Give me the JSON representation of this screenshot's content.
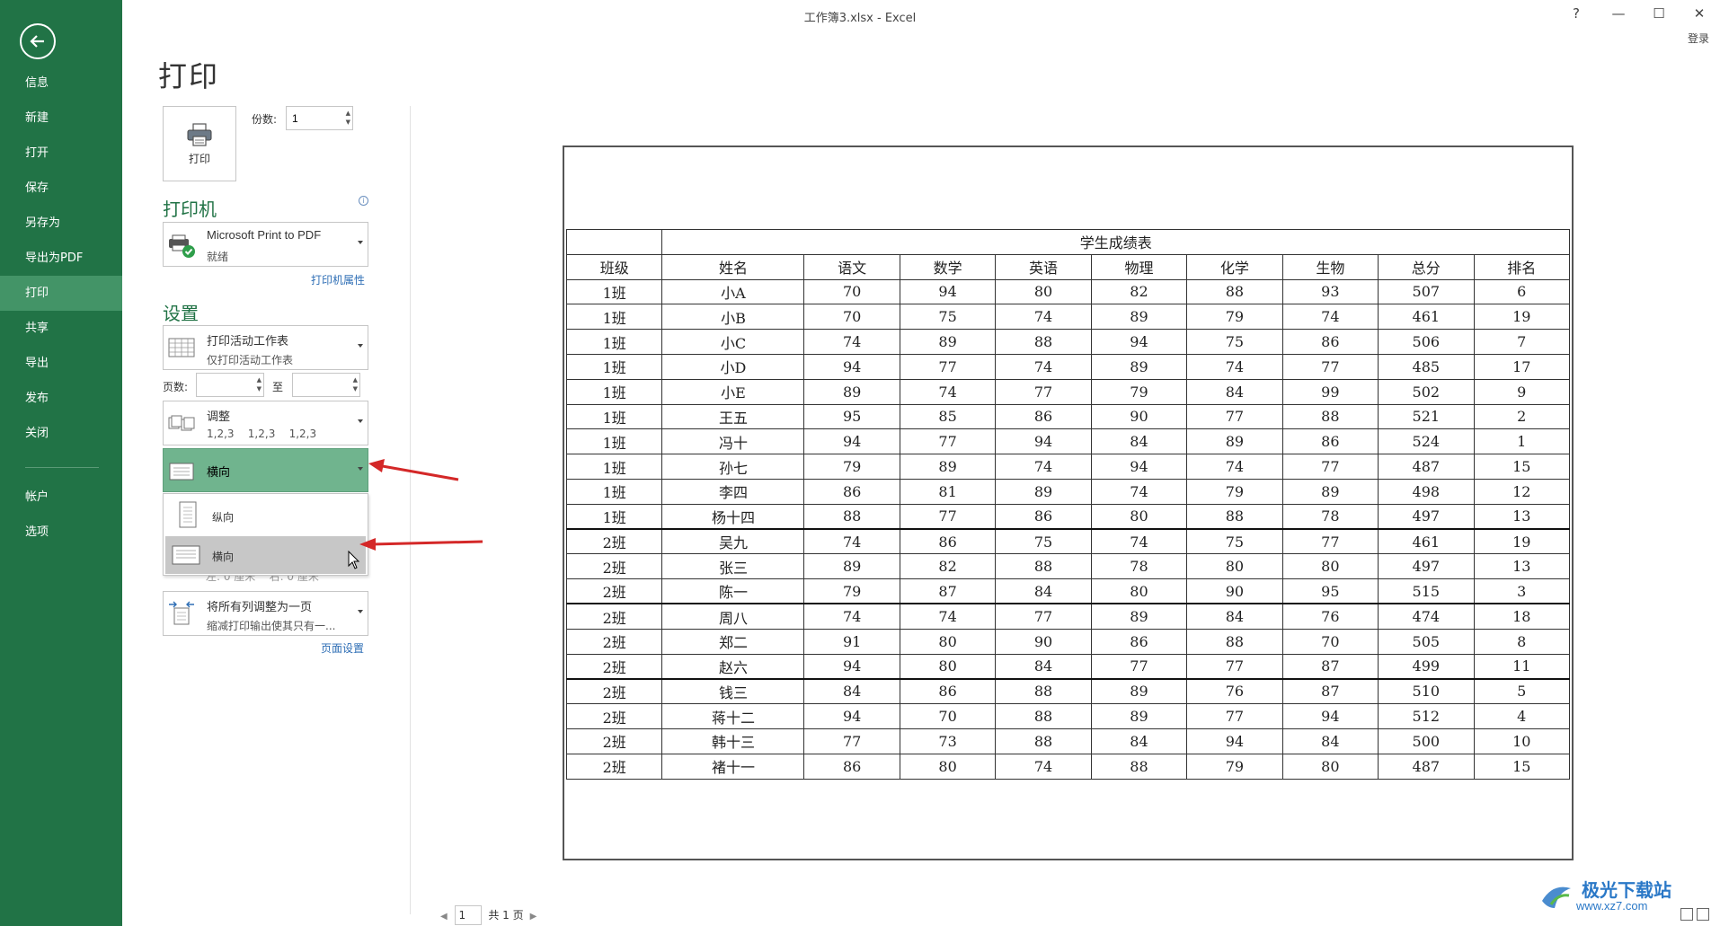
{
  "window": {
    "title": "工作簿3.xlsx - Excel",
    "help": "?",
    "minimize": "—",
    "maximize": "☐",
    "close": "✕",
    "login": "登录"
  },
  "sidebar": {
    "items": [
      {
        "label": "信息"
      },
      {
        "label": "新建"
      },
      {
        "label": "打开"
      },
      {
        "label": "保存"
      },
      {
        "label": "另存为"
      },
      {
        "label": "导出为PDF"
      },
      {
        "label": "打印"
      },
      {
        "label": "共享"
      },
      {
        "label": "导出"
      },
      {
        "label": "发布"
      },
      {
        "label": "关闭"
      }
    ],
    "bottom_items": [
      {
        "label": "帐户"
      },
      {
        "label": "选项"
      }
    ],
    "active": "打印"
  },
  "print": {
    "title": "打印",
    "button_label": "打印",
    "copies_label": "份数:",
    "copies_value": "1"
  },
  "printer": {
    "section_title": "打印机",
    "name": "Microsoft Print to PDF",
    "status": "就绪",
    "properties_link": "打印机属性"
  },
  "settings": {
    "section_title": "设置",
    "scope_main": "打印活动工作表",
    "scope_sub": "仅打印活动工作表",
    "pages_label": "页数:",
    "pages_from": "",
    "to_label": "至",
    "pages_to": "",
    "collate_main": "调整",
    "collate_sub": "1,2,3    1,2,3    1,2,3",
    "orientation_selected": "横向",
    "orientation_options": [
      {
        "label": "纵向"
      },
      {
        "label": "横向"
      }
    ],
    "margins_partial": "左: 0 厘米    右: 0 厘米",
    "scaling_main": "将所有列调整为一页",
    "scaling_sub": "缩减打印输出使其只有一...",
    "page_setup_link": "页面设置"
  },
  "preview": {
    "table_title": "学生成绩表",
    "headers": [
      "班级",
      "姓名",
      "语文",
      "数学",
      "英语",
      "物理",
      "化学",
      "生物",
      "总分",
      "排名"
    ],
    "rows": [
      [
        "1班",
        "小A",
        "70",
        "94",
        "80",
        "82",
        "88",
        "93",
        "507",
        "6"
      ],
      [
        "1班",
        "小B",
        "70",
        "75",
        "74",
        "89",
        "79",
        "74",
        "461",
        "19"
      ],
      [
        "1班",
        "小C",
        "74",
        "89",
        "88",
        "94",
        "75",
        "86",
        "506",
        "7"
      ],
      [
        "1班",
        "小D",
        "94",
        "77",
        "74",
        "89",
        "74",
        "77",
        "485",
        "17"
      ],
      [
        "1班",
        "小E",
        "89",
        "74",
        "77",
        "79",
        "84",
        "99",
        "502",
        "9"
      ],
      [
        "1班",
        "王五",
        "95",
        "85",
        "86",
        "90",
        "77",
        "88",
        "521",
        "2"
      ],
      [
        "1班",
        "冯十",
        "94",
        "77",
        "94",
        "84",
        "89",
        "86",
        "524",
        "1"
      ],
      [
        "1班",
        "孙七",
        "79",
        "89",
        "74",
        "94",
        "74",
        "77",
        "487",
        "15"
      ],
      [
        "1班",
        "李四",
        "86",
        "81",
        "89",
        "74",
        "79",
        "89",
        "498",
        "12"
      ],
      [
        "1班",
        "杨十四",
        "88",
        "77",
        "86",
        "80",
        "88",
        "78",
        "497",
        "13"
      ],
      [
        "2班",
        "吴九",
        "74",
        "86",
        "75",
        "74",
        "75",
        "77",
        "461",
        "19"
      ],
      [
        "2班",
        "张三",
        "89",
        "82",
        "88",
        "78",
        "80",
        "80",
        "497",
        "13"
      ],
      [
        "2班",
        "陈一",
        "79",
        "87",
        "84",
        "80",
        "90",
        "95",
        "515",
        "3"
      ],
      [
        "2班",
        "周八",
        "74",
        "74",
        "77",
        "89",
        "84",
        "76",
        "474",
        "18"
      ],
      [
        "2班",
        "郑二",
        "91",
        "80",
        "90",
        "86",
        "88",
        "70",
        "505",
        "8"
      ],
      [
        "2班",
        "赵六",
        "94",
        "80",
        "84",
        "77",
        "77",
        "87",
        "499",
        "11"
      ],
      [
        "2班",
        "钱三",
        "84",
        "86",
        "88",
        "89",
        "76",
        "87",
        "510",
        "5"
      ],
      [
        "2班",
        "蒋十二",
        "94",
        "70",
        "88",
        "89",
        "77",
        "94",
        "512",
        "4"
      ],
      [
        "2班",
        "韩十三",
        "77",
        "73",
        "88",
        "84",
        "94",
        "84",
        "500",
        "10"
      ],
      [
        "2班",
        "褚十一",
        "86",
        "80",
        "74",
        "88",
        "79",
        "80",
        "487",
        "15"
      ]
    ],
    "thick_rows": [
      10,
      13,
      16
    ]
  },
  "pager": {
    "current": "1",
    "total": "共 1 页"
  },
  "watermark": {
    "title": "极光下载站",
    "url": "www.xz7.com"
  },
  "colors": {
    "sidebar": "#217346",
    "sidebar_active": "#439467",
    "accent_green": "#217346",
    "link_blue": "#2e6eb5",
    "annotation_red": "#d42828"
  }
}
